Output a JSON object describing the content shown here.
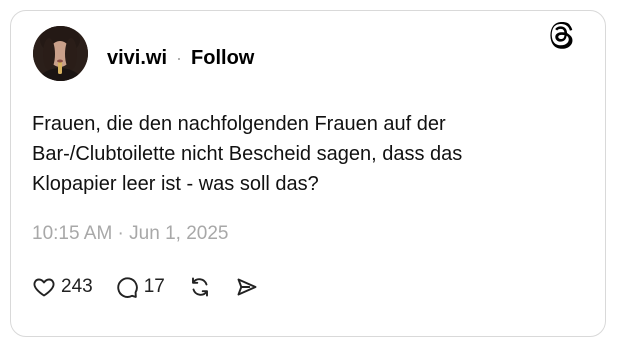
{
  "post": {
    "author": {
      "username": "vivi.wi",
      "avatar_icon": "avatar-photo"
    },
    "separator": "·",
    "follow_label": "Follow",
    "logo_icon": "threads-logo-icon",
    "text_lines": [
      "Frauen, die den nachfolgenden Frauen auf der",
      "Bar-/Clubtoilette nicht Bescheid sagen, dass das",
      "Klopapier leer ist - was soll das?"
    ],
    "timestamp": "10:15 AM · Jun 1, 2025",
    "actions": {
      "like": {
        "icon": "heart-icon",
        "count": "243"
      },
      "reply": {
        "icon": "comment-icon",
        "count": "17"
      },
      "repost": {
        "icon": "repost-icon"
      },
      "share": {
        "icon": "share-icon"
      }
    }
  },
  "colors": {
    "text": "#000000",
    "muted": "#a8a8a8",
    "border": "#d9d9d9",
    "background": "#ffffff"
  }
}
